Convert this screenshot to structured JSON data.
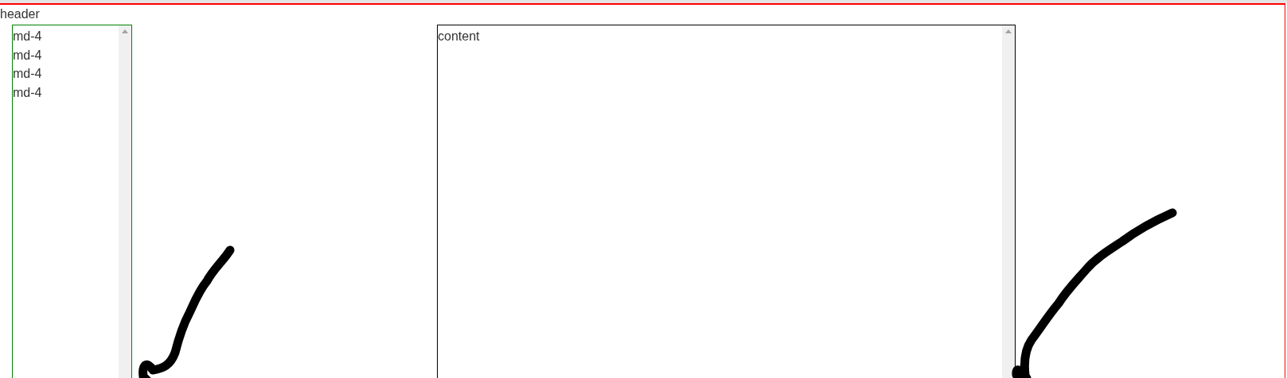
{
  "header": {
    "title": "header"
  },
  "sidebar": {
    "items": [
      {
        "label": "md-4"
      },
      {
        "label": "md-4"
      },
      {
        "label": "md-4"
      },
      {
        "label": "md-4"
      }
    ]
  },
  "content": {
    "text": "content"
  }
}
